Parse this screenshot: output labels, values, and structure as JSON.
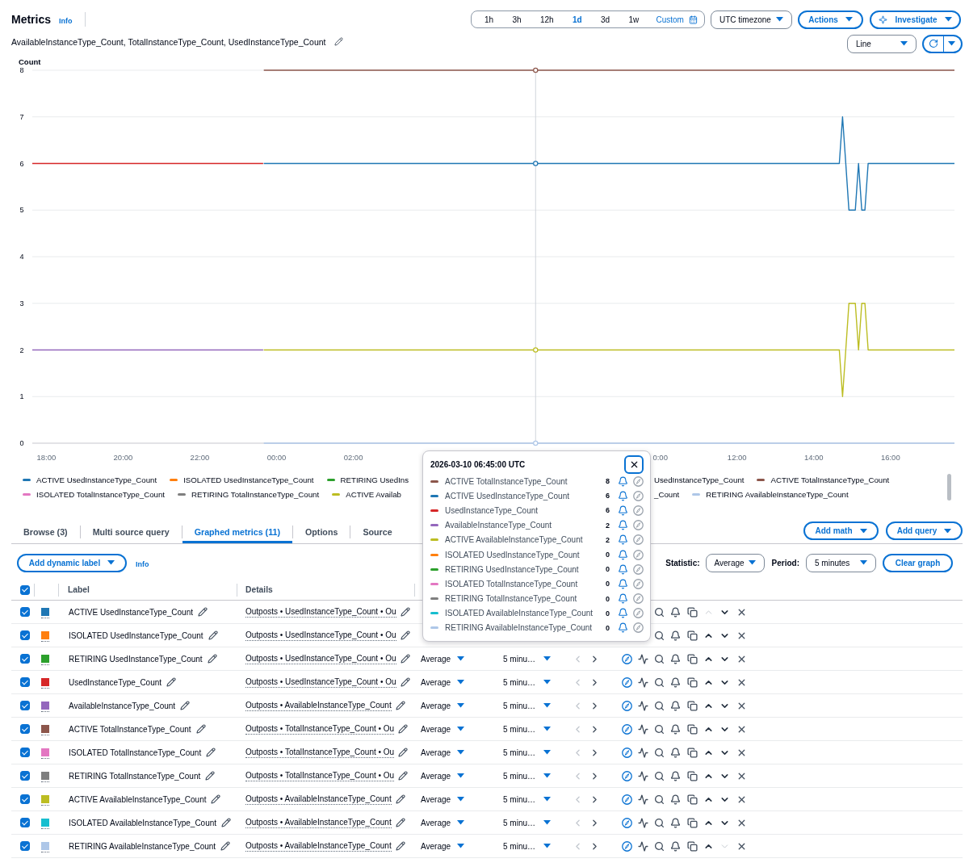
{
  "header": {
    "title": "Metrics",
    "info_link": "Info",
    "time_ranges": [
      {
        "label": "1h",
        "selected": false
      },
      {
        "label": "3h",
        "selected": false
      },
      {
        "label": "12h",
        "selected": false
      },
      {
        "label": "1d",
        "selected": true
      },
      {
        "label": "3d",
        "selected": false
      },
      {
        "label": "1w",
        "selected": false
      }
    ],
    "custom_range": "Custom",
    "timezone": "UTC timezone",
    "actions_button": "Actions",
    "investigate_button": "Investigate"
  },
  "graph": {
    "title": "AvailableInstanceType_Count, TotalInstanceType_Count, UsedInstanceType_Count",
    "view": "Line",
    "chart_data": {
      "type": "line",
      "ylabel": "Count",
      "grid": true,
      "x": [
        "2026-03-09T17:38:00Z",
        "2026-03-09T23:39:00Z",
        "2026-03-09T23:40:00Z",
        "2026-03-10T14:30:00Z",
        "2026-03-10T14:35:00Z",
        "2026-03-10T14:40:00Z",
        "2026-03-10T14:45:00Z",
        "2026-03-10T14:50:00Z",
        "2026-03-10T14:55:00Z",
        "2026-03-10T15:00:00Z",
        "2026-03-10T15:05:00Z",
        "2026-03-10T15:10:00Z",
        "2026-03-10T15:15:00Z",
        "2026-03-10T15:20:00Z",
        "2026-03-10T15:25:00Z",
        "2026-03-10T15:30:00Z",
        "2026-03-10T17:40:00Z"
      ],
      "xlim": [
        "2026-03-09T17:38:00Z",
        "2026-03-10T17:40:00Z"
      ],
      "ylim": [
        0,
        8
      ],
      "xticks": [
        {
          "value": "2026-03-09T18:00:00Z",
          "label": "18:00"
        },
        {
          "value": "2026-03-09T20:00:00Z",
          "label": "20:00"
        },
        {
          "value": "2026-03-09T22:00:00Z",
          "label": "22:00"
        },
        {
          "value": "2026-03-10T00:00:00Z",
          "label": "00:00"
        },
        {
          "value": "2026-03-10T02:00:00Z",
          "label": "02:00"
        },
        {
          "value": "2026-03-10T10:00:00Z",
          "label": "0:00"
        },
        {
          "value": "2026-03-10T12:00:00Z",
          "label": "12:00"
        },
        {
          "value": "2026-03-10T14:00:00Z",
          "label": "14:00"
        },
        {
          "value": "2026-03-10T16:00:00Z",
          "label": "16:00"
        }
      ],
      "yticks": [
        0,
        1,
        2,
        3,
        4,
        5,
        6,
        7,
        8
      ],
      "series": [
        {
          "color": "#d62728",
          "values": [
            6,
            6,
            null,
            null,
            null,
            null,
            null,
            null,
            null,
            null,
            null,
            null,
            null,
            null,
            null,
            null,
            null
          ]
        },
        {
          "color": "#9467bd",
          "values": [
            2,
            2,
            null,
            null,
            null,
            null,
            null,
            null,
            null,
            null,
            null,
            null,
            null,
            null,
            null,
            null,
            null
          ]
        },
        {
          "color": "#8c564b",
          "values": [
            null,
            null,
            8,
            8,
            8,
            8,
            8,
            8,
            8,
            8,
            8,
            8,
            8,
            8,
            8,
            8,
            8
          ]
        },
        {
          "color": "#1f77b4",
          "values": [
            null,
            null,
            6,
            6,
            6,
            6,
            7,
            6,
            5,
            5,
            5,
            6,
            5,
            5,
            6,
            6,
            6
          ]
        },
        {
          "color": "#bcbd22",
          "values": [
            null,
            null,
            2,
            2,
            2,
            2,
            1,
            2,
            3,
            3,
            3,
            2,
            3,
            3,
            2,
            2,
            2
          ]
        },
        {
          "color": "#aec7e8",
          "values": [
            null,
            null,
            0,
            0,
            0,
            0,
            0,
            0,
            0,
            0,
            0,
            0,
            0,
            0,
            0,
            0,
            0
          ]
        }
      ],
      "ref_lines": [
        {
          "axis": "x",
          "value": "2026-03-10T06:45:00Z"
        }
      ]
    }
  },
  "legend": [
    {
      "left": [
        {
          "label": "ACTIVE UsedInstanceType_Count",
          "color": "#1f77b4"
        },
        {
          "label": "ISOLATED UsedInstanceType_Count",
          "color": "#ff7f0e"
        },
        {
          "label": "RETIRING UsedIns",
          "color": "#2ca02c"
        }
      ],
      "right": [
        {
          "label": "UsedInstanceType_Count"
        },
        {
          "label": "ACTIVE TotalInstanceType_Count",
          "color": "#8c564b"
        }
      ]
    },
    {
      "left": [
        {
          "label": "ISOLATED TotalInstanceType_Count",
          "color": "#e377c2"
        },
        {
          "label": "RETIRING TotalInstanceType_Count",
          "color": "#7f7f7f"
        },
        {
          "label": "ACTIVE Availab",
          "color": "#bcbd22"
        }
      ],
      "right": [
        {
          "label": "_Count"
        },
        {
          "label": "RETIRING AvailableInstanceType_Count",
          "color": "#aec7e8"
        }
      ]
    }
  ],
  "tooltip": {
    "timestamp": "2026-03-10 06:45:00 UTC",
    "items": [
      {
        "label": "ACTIVE TotalInstanceType_Count",
        "color": "#8c564b",
        "value": "8"
      },
      {
        "label": "ACTIVE UsedInstanceType_Count",
        "color": "#1f77b4",
        "value": "6"
      },
      {
        "label": "UsedInstanceType_Count",
        "color": "#d62728",
        "value": "6"
      },
      {
        "label": "AvailableInstanceType_Count",
        "color": "#9467bd",
        "value": "2"
      },
      {
        "label": "ACTIVE AvailableInstanceType_Count",
        "color": "#bcbd22",
        "value": "2"
      },
      {
        "label": "ISOLATED UsedInstanceType_Count",
        "color": "#ff7f0e",
        "value": "0"
      },
      {
        "label": "RETIRING UsedInstanceType_Count",
        "color": "#2ca02c",
        "value": "0"
      },
      {
        "label": "ISOLATED TotalInstanceType_Count",
        "color": "#e377c2",
        "value": "0"
      },
      {
        "label": "RETIRING TotalInstanceType_Count",
        "color": "#7f7f7f",
        "value": "0"
      },
      {
        "label": "ISOLATED AvailableInstanceType_Count",
        "color": "#17becf",
        "value": "0"
      },
      {
        "label": "RETIRING AvailableInstanceType_Count",
        "color": "#aec7e8",
        "value": "0"
      }
    ]
  },
  "tabs": [
    {
      "label": "Browse (3)",
      "selected": false
    },
    {
      "label": "Multi source query",
      "selected": false
    },
    {
      "label": "Graphed metrics (11)",
      "selected": true
    },
    {
      "label": "Options",
      "selected": false
    },
    {
      "label": "Source",
      "selected": false
    }
  ],
  "tab_actions": {
    "add_math": "Add math",
    "add_query": "Add query"
  },
  "toolbar": {
    "dynamic_label_button": "Add dynamic label",
    "info_link": "Info",
    "statistic_label": "Statistic:",
    "statistic": "Average",
    "period_label": "Period:",
    "period": "5 minutes",
    "clear_button": "Clear graph"
  },
  "table": {
    "all_checked": true,
    "columns": [
      "Label",
      "Details"
    ],
    "rows": [
      {
        "checked": true,
        "color": "#1f77b4",
        "label": "ACTIVE UsedInstanceType_Count",
        "details": "Outposts • UsedInstanceType_Count • Ou",
        "move_up_disabled": true,
        "move_down_disabled": false
      },
      {
        "checked": true,
        "color": "#ff7f0e",
        "label": "ISOLATED UsedInstanceType_Count",
        "details": "Outposts • UsedInstanceType_Count • Ou",
        "move_up_disabled": false,
        "move_down_disabled": false
      },
      {
        "checked": true,
        "color": "#2ca02c",
        "label": "RETIRING UsedInstanceType_Count",
        "details": "Outposts • UsedInstanceType_Count • Ou",
        "statistic": "Average",
        "period": "5 minu…",
        "move_up_disabled": false,
        "move_down_disabled": false
      },
      {
        "checked": true,
        "color": "#d62728",
        "label": "UsedInstanceType_Count",
        "details": "Outposts • UsedInstanceType_Count • Ou",
        "statistic": "Average",
        "period": "5 minu…",
        "move_up_disabled": false,
        "move_down_disabled": false
      },
      {
        "checked": true,
        "color": "#9467bd",
        "label": "AvailableInstanceType_Count",
        "details": "Outposts • AvailableInstanceType_Count",
        "statistic": "Average",
        "period": "5 minu…",
        "move_up_disabled": false,
        "move_down_disabled": false
      },
      {
        "checked": true,
        "color": "#8c564b",
        "label": "ACTIVE TotalInstanceType_Count",
        "details": "Outposts • TotalInstanceType_Count • Ou",
        "statistic": "Average",
        "period": "5 minu…",
        "move_up_disabled": false,
        "move_down_disabled": false
      },
      {
        "checked": true,
        "color": "#e377c2",
        "label": "ISOLATED TotalInstanceType_Count",
        "details": "Outposts • TotalInstanceType_Count • Ou",
        "statistic": "Average",
        "period": "5 minu…",
        "move_up_disabled": false,
        "move_down_disabled": false
      },
      {
        "checked": true,
        "color": "#7f7f7f",
        "label": "RETIRING TotalInstanceType_Count",
        "details": "Outposts • TotalInstanceType_Count • Ou",
        "statistic": "Average",
        "period": "5 minu…",
        "move_up_disabled": false,
        "move_down_disabled": false
      },
      {
        "checked": true,
        "color": "#bcbd22",
        "label": "ACTIVE AvailableInstanceType_Count",
        "details": "Outposts • AvailableInstanceType_Count",
        "statistic": "Average",
        "period": "5 minu…",
        "move_up_disabled": false,
        "move_down_disabled": false
      },
      {
        "checked": true,
        "color": "#17becf",
        "label": "ISOLATED AvailableInstanceType_Count",
        "details": "Outposts • AvailableInstanceType_Count",
        "statistic": "Average",
        "period": "5 minu…",
        "move_up_disabled": false,
        "move_down_disabled": false
      },
      {
        "checked": true,
        "color": "#aec7e8",
        "label": "RETIRING AvailableInstanceType_Count",
        "details": "Outposts • AvailableInstanceType_Count",
        "statistic": "Average",
        "period": "5 minu…",
        "move_up_disabled": false,
        "move_down_disabled": true
      }
    ]
  }
}
